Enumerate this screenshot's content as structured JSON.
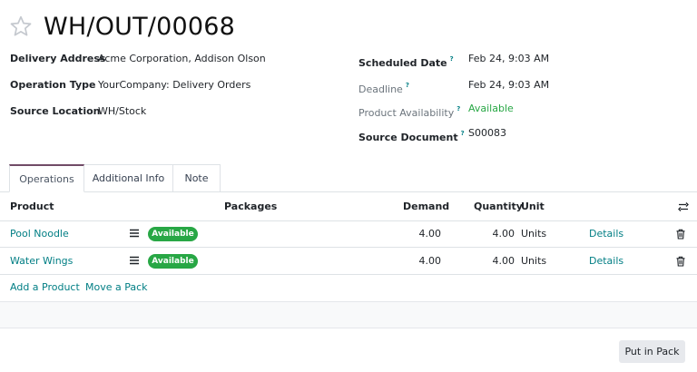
{
  "record": {
    "title": "WH/OUT/00068"
  },
  "left_fields": [
    {
      "label": "Delivery Address",
      "value": "Acme Corporation, Addison Olson"
    },
    {
      "label": "Operation Type",
      "value": "YourCompany: Delivery Orders"
    },
    {
      "label": "Source Location",
      "value": "WH/Stock"
    }
  ],
  "right_fields": [
    {
      "label": "Scheduled Date",
      "help": "?",
      "value": "Feb 24, 9:03 AM"
    },
    {
      "label": "Deadline",
      "help": "?",
      "value": "Feb 24, 9:03 AM"
    },
    {
      "label": "Product Availability",
      "help": "?",
      "value": "Available",
      "value_color": "#28a745"
    },
    {
      "label": "Source Document",
      "help": "?",
      "value": "S00083"
    }
  ],
  "tabs": [
    {
      "label": "Operations",
      "active": true
    },
    {
      "label": "Additional Info",
      "active": false
    },
    {
      "label": "Note",
      "active": false
    }
  ],
  "table": {
    "columns": [
      "Product",
      "Packages",
      "Demand",
      "Quantity",
      "Unit"
    ],
    "rows": [
      {
        "product": "Pool Noodle",
        "status": "Available",
        "demand": "4.00",
        "quantity": "4.00",
        "unit": "Units",
        "details": "Details"
      },
      {
        "product": "Water Wings",
        "status": "Available",
        "demand": "4.00",
        "quantity": "4.00",
        "unit": "Units",
        "details": "Details"
      }
    ],
    "actions": {
      "add_product": "Add a Product",
      "move_pack": "Move a Pack"
    }
  },
  "footer": {
    "put_in_pack": "Put in Pack"
  },
  "colors": {
    "accent": "#017e84",
    "tab_active": "#714b67",
    "badge_green": "#28a745"
  },
  "icons": [
    "star-icon",
    "settings-toggle-icon",
    "list-icon",
    "trash-icon"
  ]
}
